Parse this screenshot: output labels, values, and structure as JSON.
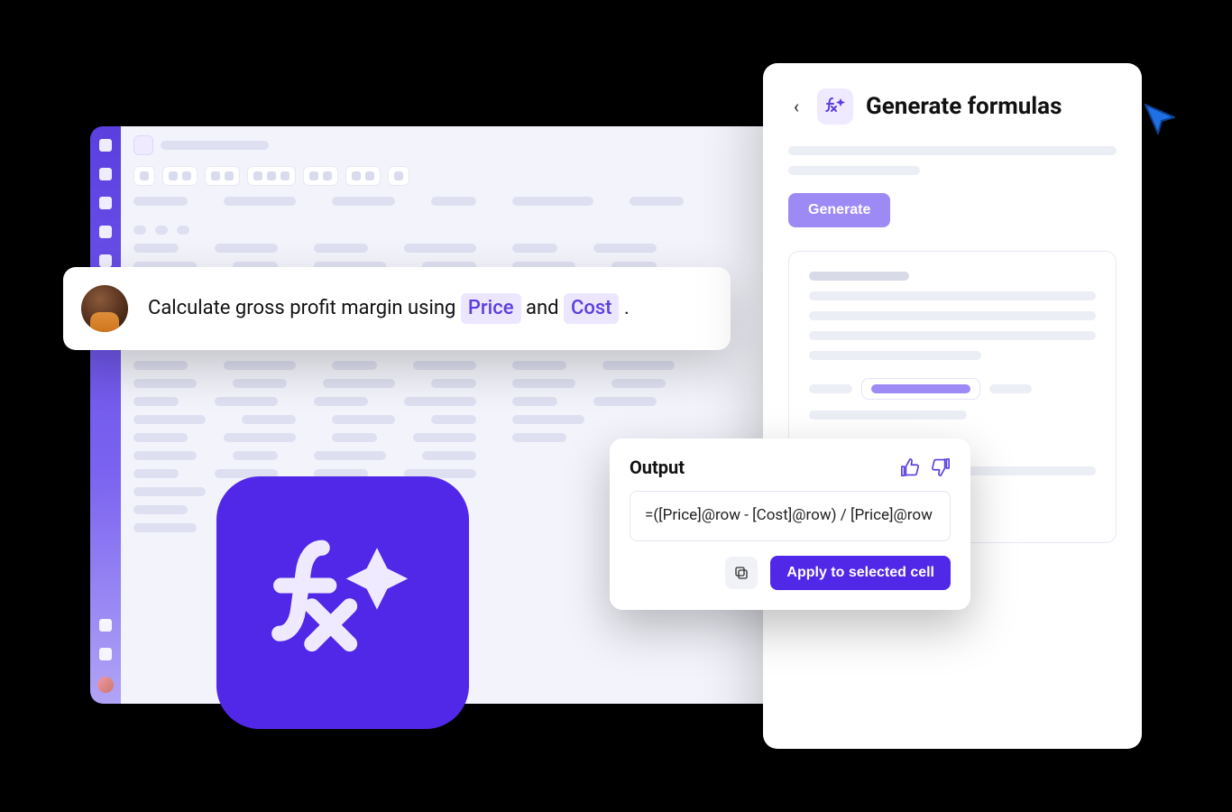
{
  "prompt": {
    "prefix": "Calculate gross profit margin using ",
    "token1": "Price",
    "mid": " and ",
    "token2": "Cost",
    "suffix": " ."
  },
  "panel": {
    "title": "Generate formulas",
    "generate_label": "Generate"
  },
  "output": {
    "title": "Output",
    "formula": "=([Price]@row - [Cost]@row) / [Price]@row",
    "apply_label": "Apply to selected cell"
  },
  "icons": {
    "back": "back-chevron",
    "fx": "fx-sparkle",
    "thumbs_up": "thumbs-up",
    "thumbs_down": "thumbs-down",
    "copy": "copy",
    "cursor": "cursor-pointer"
  }
}
